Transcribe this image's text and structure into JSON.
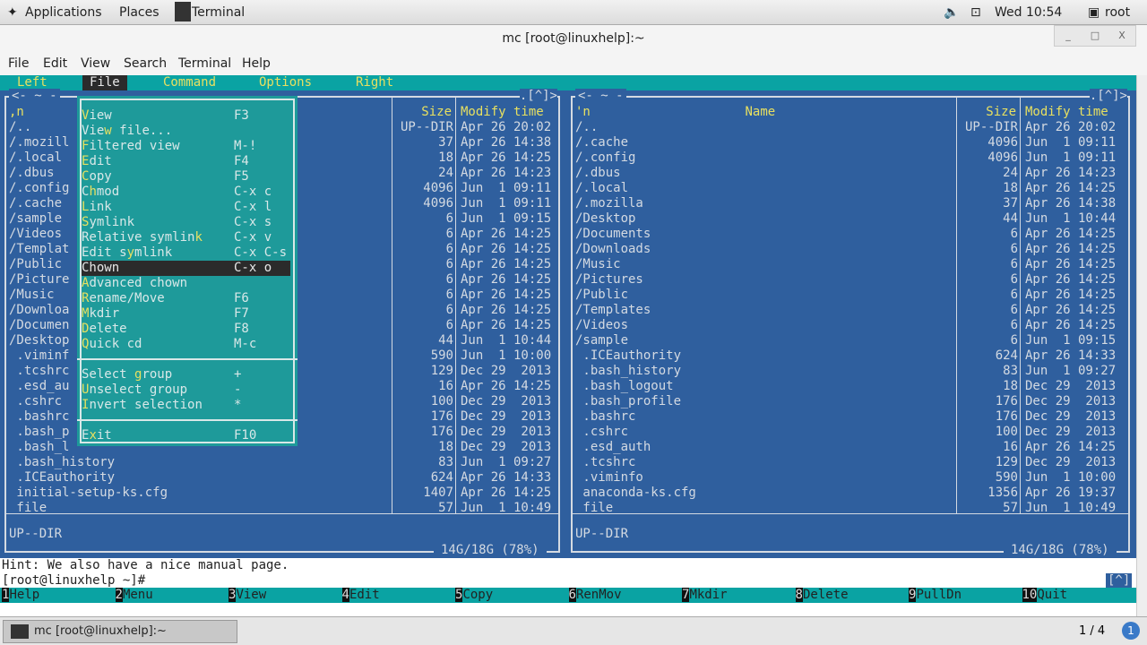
{
  "topbar": {
    "applications": "Applications",
    "places": "Places",
    "terminal": "Terminal",
    "clock": "Wed 10:54",
    "user": "root"
  },
  "window": {
    "title": "mc [root@linuxhelp]:~",
    "minimize": "_",
    "maximize": "□",
    "close": "X"
  },
  "menubar": [
    "File",
    "Edit",
    "View",
    "Search",
    "Terminal",
    "Help"
  ],
  "mc_menu": {
    "items": [
      "Left",
      "File",
      "Command",
      "Options",
      "Right"
    ],
    "active": "File"
  },
  "left_panel": {
    "path": "~",
    "corner": ".[^]>",
    "headers": {
      "name": ",n",
      "size": "Size",
      "time": "Modify time"
    },
    "rows": [
      [
        "/..",
        "UP--DIR",
        "Apr 26 20:02"
      ],
      [
        "/.mozill",
        "37",
        "Apr 26 14:38"
      ],
      [
        "/.local",
        "18",
        "Apr 26 14:25"
      ],
      [
        "/.dbus",
        "24",
        "Apr 26 14:23"
      ],
      [
        "/.config",
        "4096",
        "Jun  1 09:11"
      ],
      [
        "/.cache",
        "4096",
        "Jun  1 09:11"
      ],
      [
        "/sample",
        "6",
        "Jun  1 09:15"
      ],
      [
        "/Videos",
        "6",
        "Apr 26 14:25"
      ],
      [
        "/Templat",
        "6",
        "Apr 26 14:25"
      ],
      [
        "/Public",
        "6",
        "Apr 26 14:25"
      ],
      [
        "/Picture",
        "6",
        "Apr 26 14:25"
      ],
      [
        "/Music",
        "6",
        "Apr 26 14:25"
      ],
      [
        "/Downloa",
        "6",
        "Apr 26 14:25"
      ],
      [
        "/Documen",
        "6",
        "Apr 26 14:25"
      ],
      [
        "/Desktop",
        "44",
        "Jun  1 10:44"
      ],
      [
        " .viminf",
        "590",
        "Jun  1 10:00"
      ],
      [
        " .tcshrc",
        "129",
        "Dec 29  2013"
      ],
      [
        " .esd_au",
        "16",
        "Apr 26 14:25"
      ],
      [
        " .cshrc",
        "100",
        "Dec 29  2013"
      ],
      [
        " .bashrc",
        "176",
        "Dec 29  2013"
      ],
      [
        " .bash_p",
        "176",
        "Dec 29  2013"
      ],
      [
        " .bash_l",
        "18",
        "Dec 29  2013"
      ],
      [
        " .bash_history",
        "83",
        "Jun  1 09:27"
      ],
      [
        " .ICEauthority",
        "624",
        "Apr 26 14:33"
      ],
      [
        " initial-setup-ks.cfg",
        "1407",
        "Apr 26 14:25"
      ],
      [
        " file",
        "57",
        "Jun  1 10:49"
      ]
    ],
    "mini_status": "UP--DIR",
    "disk": " 14G/18G (78%) "
  },
  "right_panel": {
    "path": "~",
    "corner": ".[^]>",
    "headers": {
      "name": "'n",
      "title": "Name",
      "size": "Size",
      "time": "Modify time"
    },
    "rows": [
      [
        "/..",
        "UP--DIR",
        "Apr 26 20:02"
      ],
      [
        "/.cache",
        "4096",
        "Jun  1 09:11"
      ],
      [
        "/.config",
        "4096",
        "Jun  1 09:11"
      ],
      [
        "/.dbus",
        "24",
        "Apr 26 14:23"
      ],
      [
        "/.local",
        "18",
        "Apr 26 14:25"
      ],
      [
        "/.mozilla",
        "37",
        "Apr 26 14:38"
      ],
      [
        "/Desktop",
        "44",
        "Jun  1 10:44"
      ],
      [
        "/Documents",
        "6",
        "Apr 26 14:25"
      ],
      [
        "/Downloads",
        "6",
        "Apr 26 14:25"
      ],
      [
        "/Music",
        "6",
        "Apr 26 14:25"
      ],
      [
        "/Pictures",
        "6",
        "Apr 26 14:25"
      ],
      [
        "/Public",
        "6",
        "Apr 26 14:25"
      ],
      [
        "/Templates",
        "6",
        "Apr 26 14:25"
      ],
      [
        "/Videos",
        "6",
        "Apr 26 14:25"
      ],
      [
        "/sample",
        "6",
        "Jun  1 09:15"
      ],
      [
        " .ICEauthority",
        "624",
        "Apr 26 14:33"
      ],
      [
        " .bash_history",
        "83",
        "Jun  1 09:27"
      ],
      [
        " .bash_logout",
        "18",
        "Dec 29  2013"
      ],
      [
        " .bash_profile",
        "176",
        "Dec 29  2013"
      ],
      [
        " .bashrc",
        "176",
        "Dec 29  2013"
      ],
      [
        " .cshrc",
        "100",
        "Dec 29  2013"
      ],
      [
        " .esd_auth",
        "16",
        "Apr 26 14:25"
      ],
      [
        " .tcshrc",
        "129",
        "Dec 29  2013"
      ],
      [
        " .viminfo",
        "590",
        "Jun  1 10:00"
      ],
      [
        " anaconda-ks.cfg",
        "1356",
        "Apr 26 19:37"
      ],
      [
        " file",
        "57",
        "Jun  1 10:49"
      ]
    ],
    "mini_status": "UP--DIR",
    "disk": " 14G/18G (78%) "
  },
  "file_menu": {
    "groups": [
      [
        [
          "",
          "V",
          "iew",
          "F3"
        ],
        [
          "Vie",
          "w",
          " file...",
          ""
        ],
        [
          "",
          "F",
          "iltered view",
          "M-!"
        ],
        [
          "",
          "E",
          "dit",
          "F4"
        ],
        [
          "",
          "C",
          "opy",
          "F5"
        ],
        [
          "C",
          "h",
          "mod",
          "C-x c"
        ],
        [
          "",
          "L",
          "ink",
          "C-x l"
        ],
        [
          "",
          "S",
          "ymlink",
          "C-x s"
        ],
        [
          "Relative symlin",
          "k",
          "",
          "C-x v"
        ],
        [
          "Edit s",
          "y",
          "mlink",
          "C-x C-s"
        ],
        [
          "Chown",
          "",
          "",
          "C-x o"
        ],
        [
          "",
          "A",
          "dvanced chown",
          ""
        ],
        [
          "",
          "R",
          "ename/Move",
          "F6"
        ],
        [
          "",
          "M",
          "kdir",
          "F7"
        ],
        [
          "",
          "D",
          "elete",
          "F8"
        ],
        [
          "",
          "Q",
          "uick cd",
          "M-c"
        ]
      ],
      [
        [
          "Select ",
          "g",
          "roup",
          "+"
        ],
        [
          "",
          "U",
          "nselect group",
          "-"
        ],
        [
          "",
          "I",
          "nvert selection",
          "*"
        ]
      ],
      [
        [
          "E",
          "x",
          "it",
          "F10"
        ]
      ]
    ],
    "active": "Chown"
  },
  "hint": "Hint: We also have a nice manual page.",
  "prompt": "[root@linuxhelp ~]#",
  "scroll_indicator": "[^]",
  "fkeys": [
    [
      "1",
      "Help"
    ],
    [
      "2",
      "Menu"
    ],
    [
      "3",
      "View"
    ],
    [
      "4",
      "Edit"
    ],
    [
      "5",
      "Copy"
    ],
    [
      "6",
      "RenMov"
    ],
    [
      "7",
      "Mkdir"
    ],
    [
      "8",
      "Delete"
    ],
    [
      "9",
      "PullDn"
    ],
    [
      "10",
      "Quit"
    ]
  ],
  "taskbar": {
    "task": "mc [root@linuxhelp]:~",
    "workspace": "1 / 4"
  },
  "colors": {
    "panel": "#2f5f9e",
    "menu": "#1e9a9a",
    "bar": "#0aa3a3",
    "hotkey": "#e8e060"
  }
}
